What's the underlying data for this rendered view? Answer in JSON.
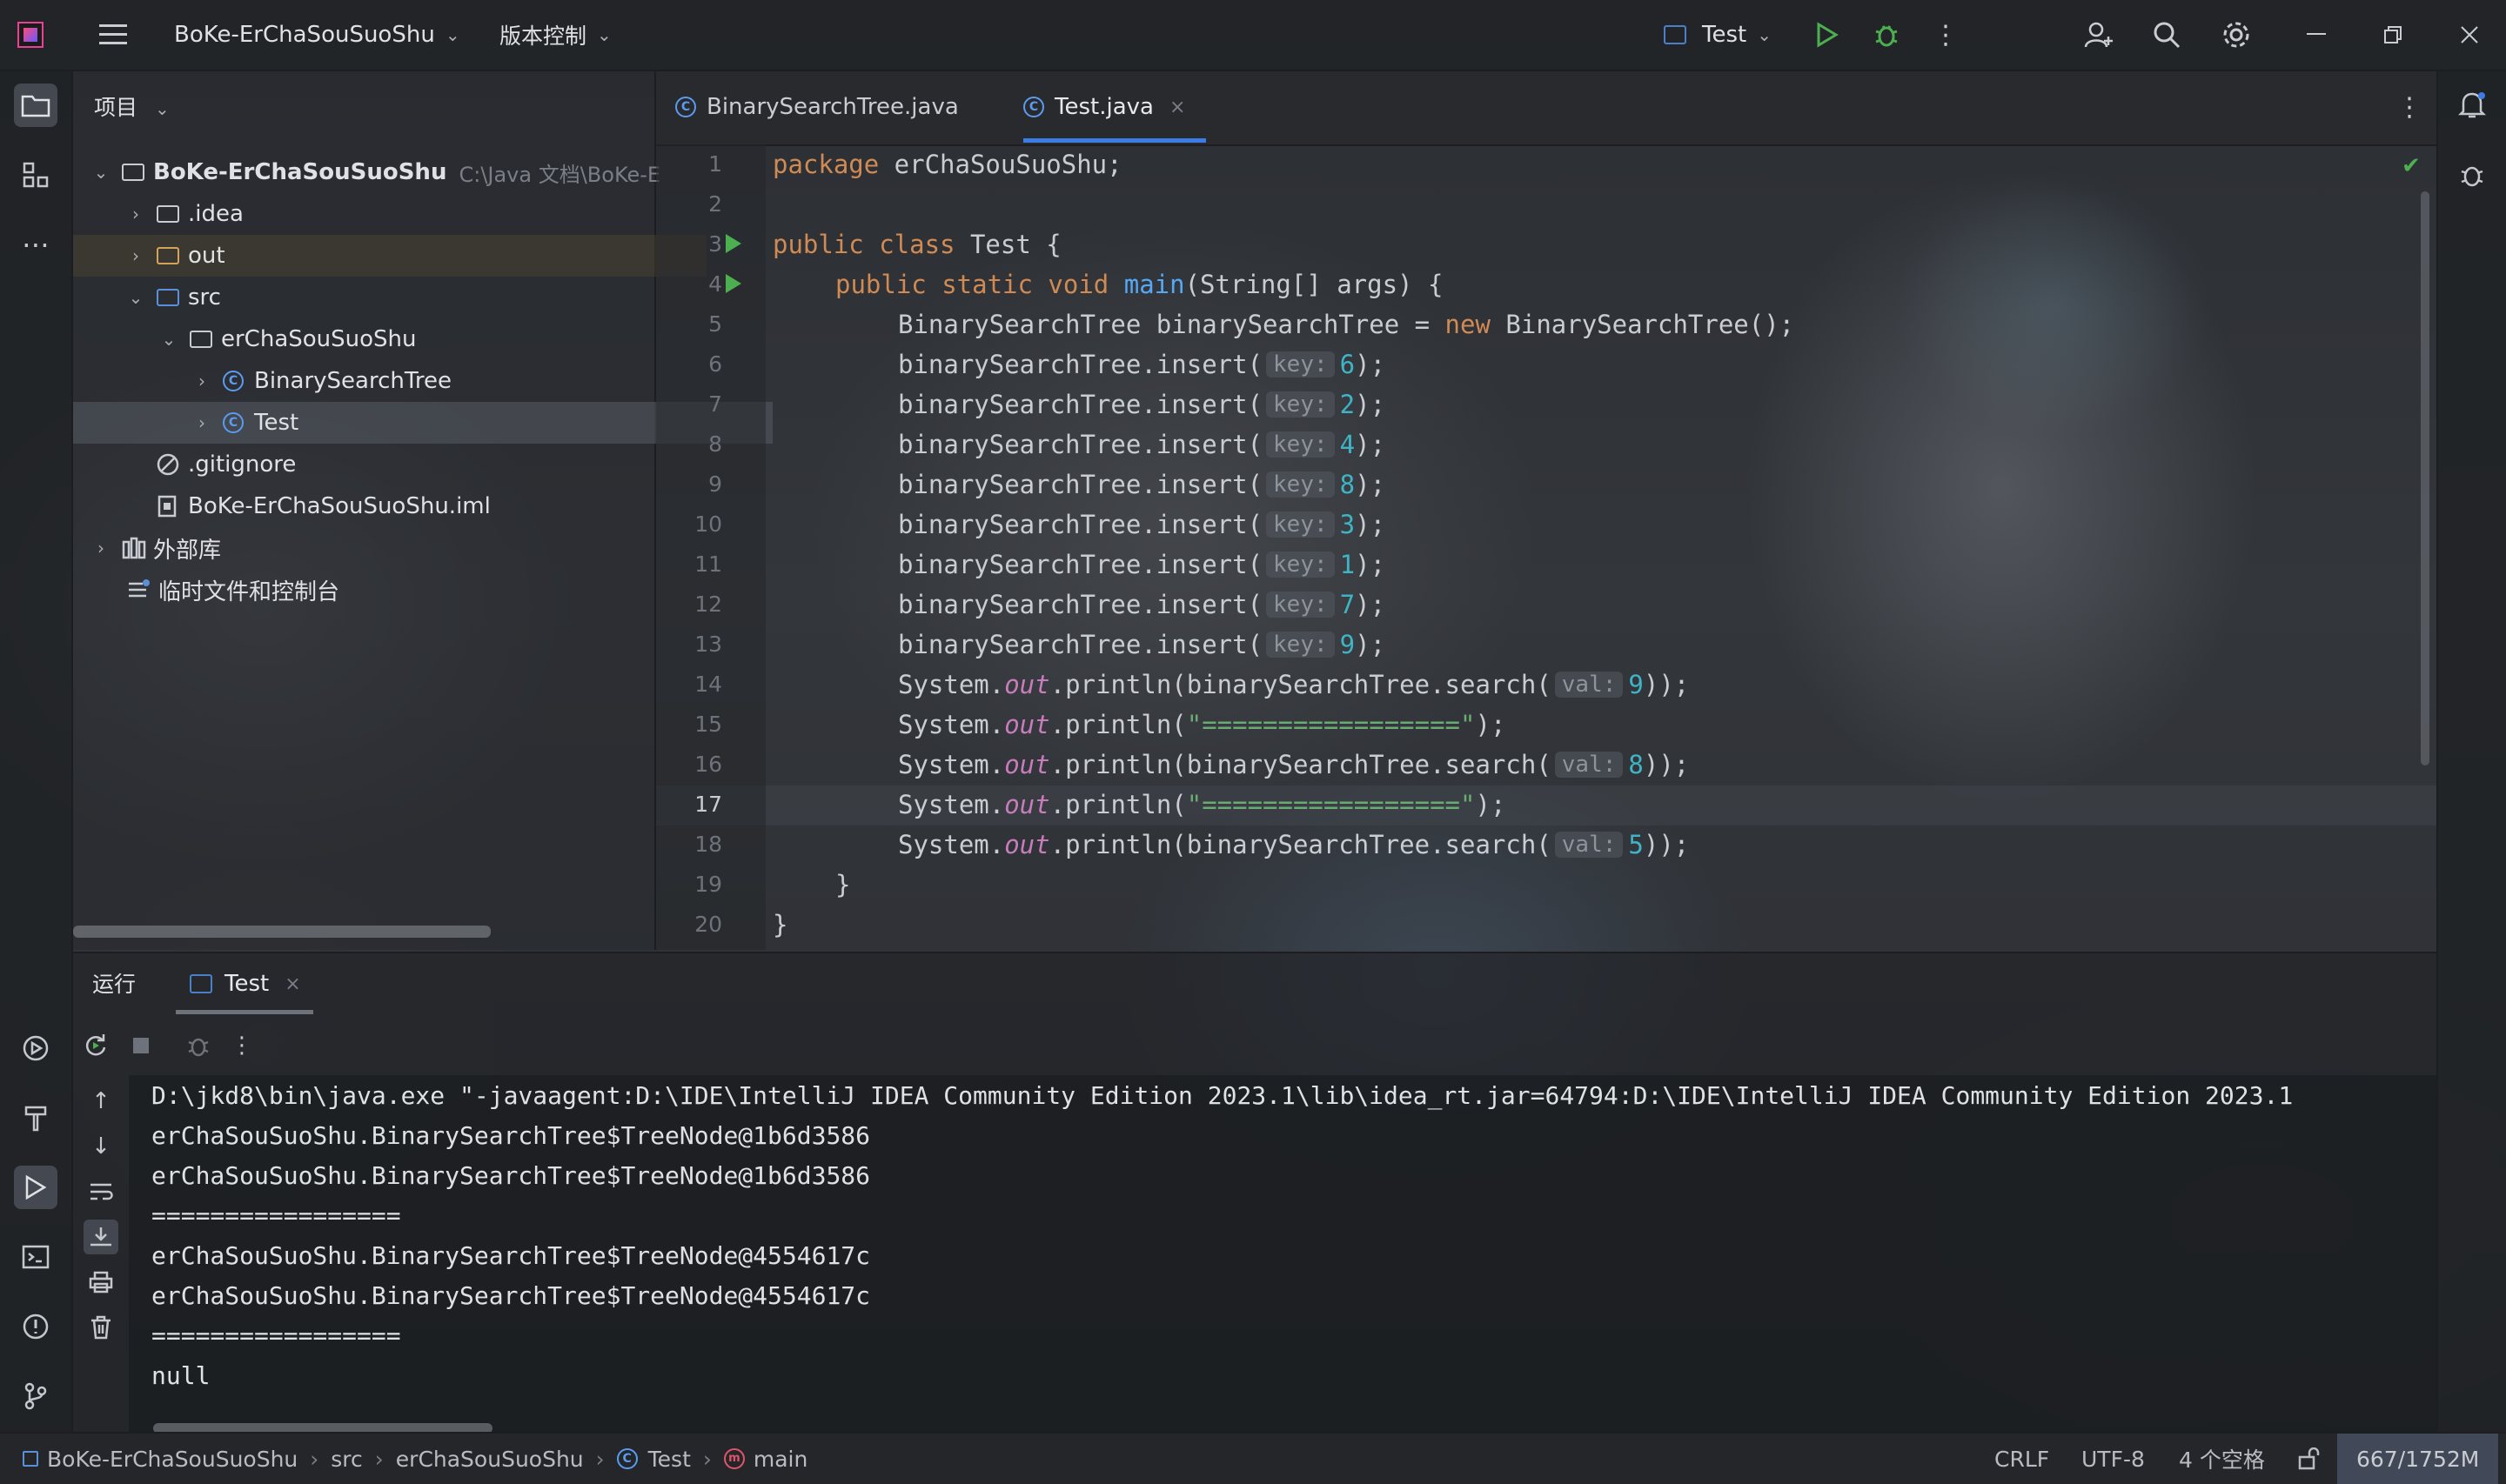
{
  "titlebar": {
    "project": "BoKe-ErChaSouSuoShu",
    "vcs": "版本控制",
    "run_config": "Test"
  },
  "project_panel": {
    "header": "项目",
    "tree": [
      {
        "label": "BoKe-ErChaSouSuoShu",
        "hint": "C:\\Java 文档\\BoKe-E"
      },
      {
        "label": ".idea"
      },
      {
        "label": "out"
      },
      {
        "label": "src"
      },
      {
        "label": "erChaSouSuoShu"
      },
      {
        "label": "BinarySearchTree"
      },
      {
        "label": "Test"
      },
      {
        "label": ".gitignore"
      },
      {
        "label": "BoKe-ErChaSouSuoShu.iml"
      },
      {
        "label": "外部库"
      },
      {
        "label": "临时文件和控制台"
      }
    ]
  },
  "editor": {
    "tabs": [
      {
        "label": "BinarySearchTree.java"
      },
      {
        "label": "Test.java"
      }
    ],
    "line_numbers": [
      "1",
      "2",
      "3",
      "4",
      "5",
      "6",
      "7",
      "8",
      "9",
      "10",
      "11",
      "12",
      "13",
      "14",
      "15",
      "16",
      "17",
      "18",
      "19",
      "20"
    ],
    "code": {
      "l1_kw": "package",
      "l1_rest": " erChaSouSuoShu;",
      "l3_kw": "public class",
      "l3_rest": " Test {",
      "l4_kw": "public static void",
      "l4_fn": "main",
      "l4_rest": "(String[] args) {",
      "l5_a": "BinarySearchTree binarySearchTree = ",
      "l5_kw": "new",
      "l5_b": " BinarySearchTree();",
      "insert_prefix": "binarySearchTree.insert(",
      "hint_key": "key:",
      "hint_val": "val:",
      "insert_values": [
        "6",
        "2",
        "4",
        "8",
        "3",
        "1",
        "7",
        "9"
      ],
      "close_paren": ");",
      "sys": "System.",
      "out": "out",
      "println_search": ".println(binarySearchTree.search(",
      "println_open": ".println(",
      "separator_str": "\"=================\"",
      "search_vals": [
        "9",
        "8",
        "5"
      ],
      "close_double": "));",
      "brace_inner": "}",
      "brace_outer": "}"
    }
  },
  "run_panel": {
    "title": "运行",
    "tab": "Test",
    "console": [
      "D:\\jkd8\\bin\\java.exe \"-javaagent:D:\\IDE\\IntelliJ IDEA Community Edition 2023.1\\lib\\idea_rt.jar=64794:D:\\IDE\\IntelliJ IDEA Community Edition 2023.1",
      "erChaSouSuoShu.BinarySearchTree$TreeNode@1b6d3586",
      "erChaSouSuoShu.BinarySearchTree$TreeNode@1b6d3586",
      "=================",
      "erChaSouSuoShu.BinarySearchTree$TreeNode@4554617c",
      "erChaSouSuoShu.BinarySearchTree$TreeNode@4554617c",
      "=================",
      "null"
    ]
  },
  "statusbar": {
    "breadcrumb": [
      "BoKe-ErChaSouSuoShu",
      "src",
      "erChaSouSuoShu",
      "Test",
      "main"
    ],
    "line_sep": "CRLF",
    "encoding": "UTF-8",
    "indent": "4 个空格",
    "memory": "667/1752M"
  },
  "colors": {
    "keyword": "#d08a53",
    "function": "#56a8f5",
    "field": "#c77dbb",
    "string": "#6aab73",
    "number": "#3eb4c4",
    "accent": "#3b7ce6",
    "run_green": "#4caf50"
  }
}
